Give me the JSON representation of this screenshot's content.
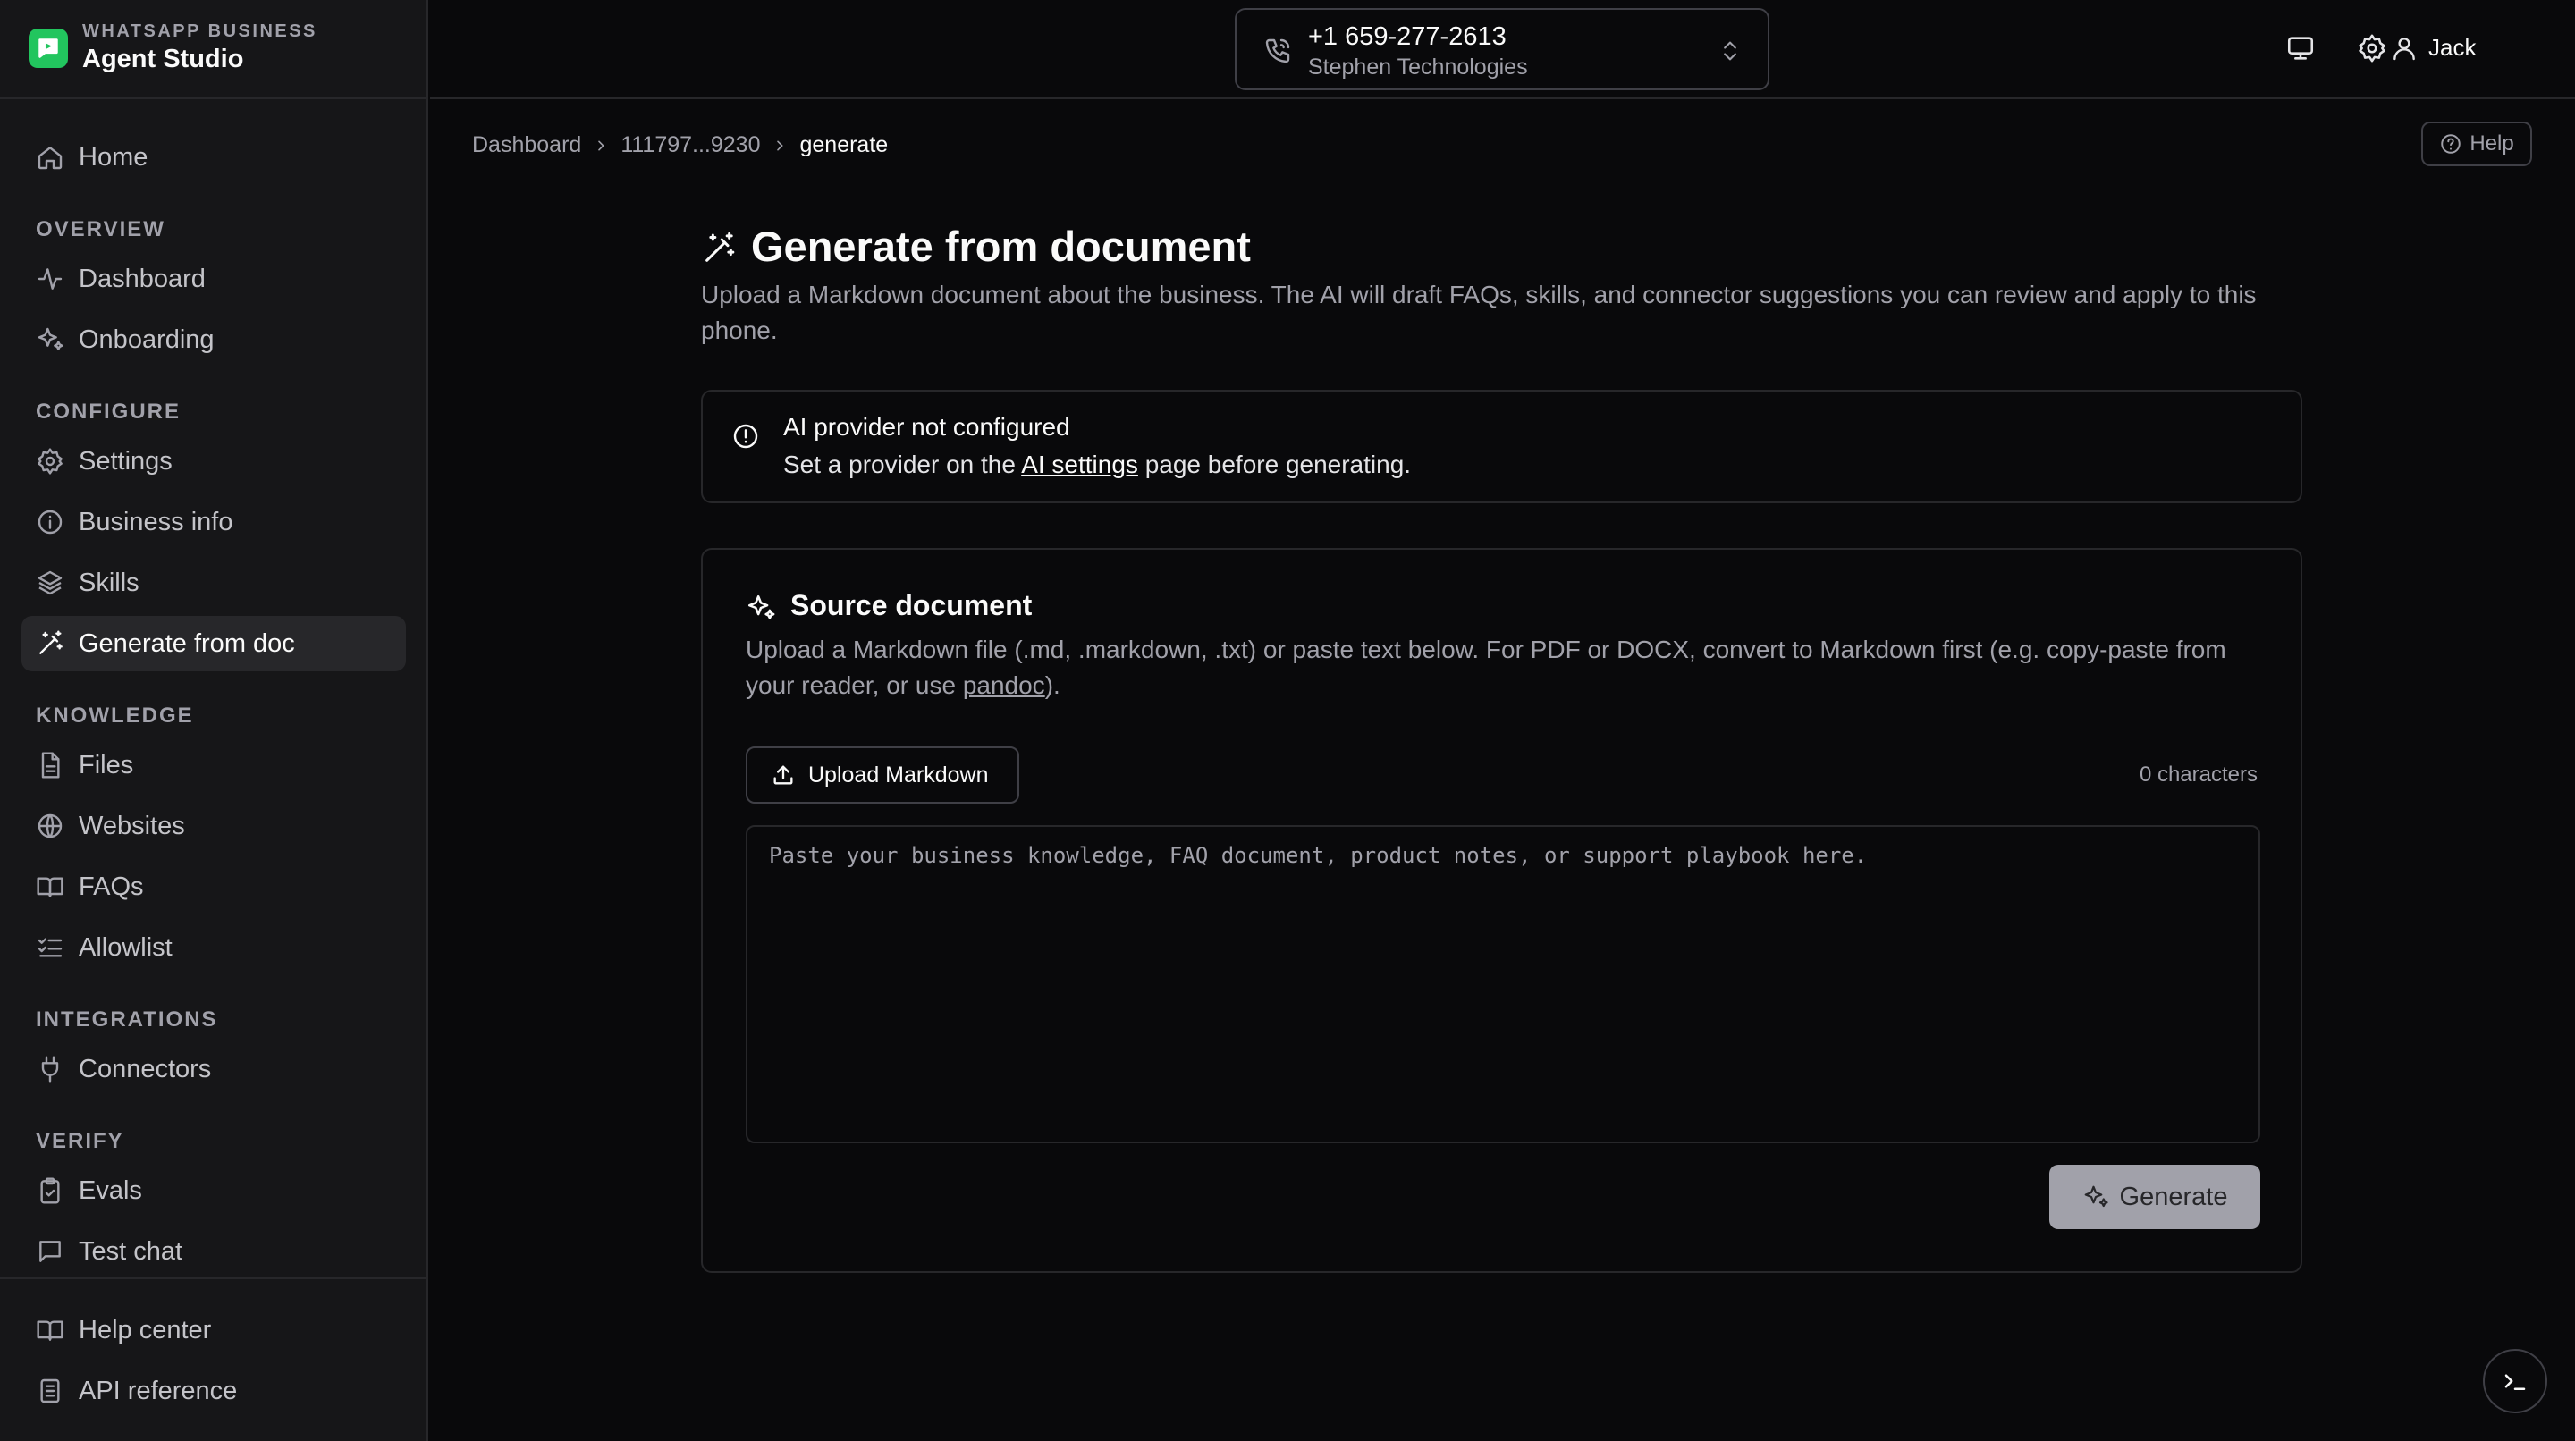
{
  "brand": {
    "kicker": "WHATSAPP BUSINESS",
    "title": "Agent Studio"
  },
  "sidebar": {
    "home": "Home",
    "sections": {
      "overview": "OVERVIEW",
      "configure": "CONFIGURE",
      "knowledge": "KNOWLEDGE",
      "integrations": "INTEGRATIONS",
      "verify": "VERIFY"
    },
    "items": {
      "dashboard": "Dashboard",
      "onboarding": "Onboarding",
      "settings": "Settings",
      "business_info": "Business info",
      "skills": "Skills",
      "generate": "Generate from doc",
      "files": "Files",
      "websites": "Websites",
      "faqs": "FAQs",
      "allowlist": "Allowlist",
      "connectors": "Connectors",
      "evals": "Evals",
      "test_chat": "Test chat"
    },
    "footer": {
      "help_center": "Help center",
      "api_reference": "API reference"
    }
  },
  "topbar": {
    "phone_number": "+1 659-277-2613",
    "company": "Stephen Technologies",
    "user": "Jack"
  },
  "breadcrumb": {
    "root": "Dashboard",
    "phone": "111797...9230",
    "current": "generate"
  },
  "help_label": "Help",
  "page": {
    "title": "Generate from document",
    "description": "Upload a Markdown document about the business. The AI will draft FAQs, skills, and connector suggestions you can review and apply to this phone."
  },
  "alert": {
    "title": "AI provider not configured",
    "body_prefix": "Set a provider on the ",
    "link": "AI settings",
    "body_suffix": " page before generating."
  },
  "source": {
    "title": "Source document",
    "desc_prefix": "Upload a Markdown file (.md, .markdown, .txt) or paste text below. For PDF or DOCX, convert to Markdown first (e.g. copy-paste from your reader, or use ",
    "desc_link": "pandoc",
    "desc_suffix": ").",
    "upload_label": "Upload Markdown",
    "char_count": "0 characters",
    "placeholder": "Paste your business knowledge, FAQ document, product notes, or support playbook here.",
    "value": "",
    "generate_label": "Generate"
  }
}
